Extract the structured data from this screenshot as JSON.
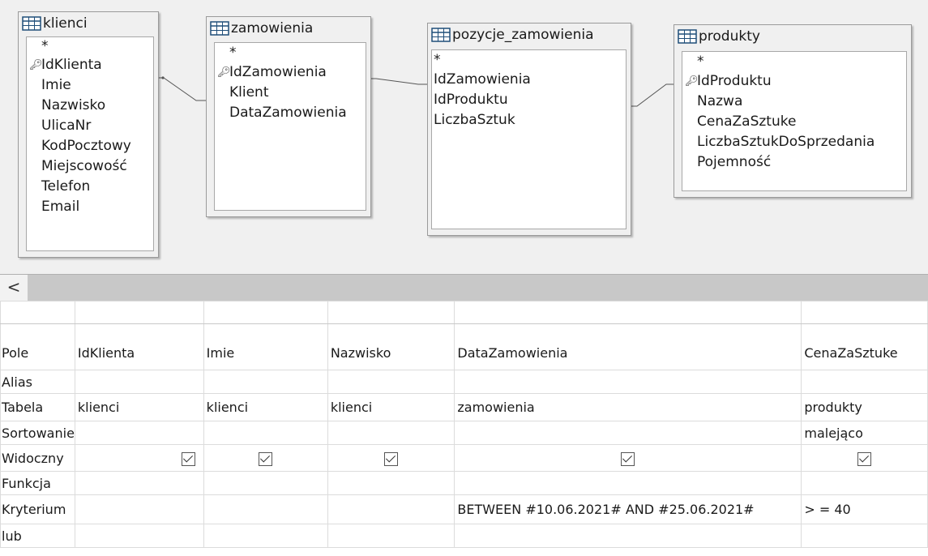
{
  "tables": {
    "klienci": {
      "title": "klienci",
      "fields": [
        "*",
        "IdKlienta",
        "Imie",
        "Nazwisko",
        "UlicaNr",
        "KodPocztowy",
        "Miejscowość",
        "Telefon",
        "Email"
      ],
      "primary_key": "IdKlienta"
    },
    "zamowienia": {
      "title": "zamowienia",
      "fields": [
        "*",
        "IdZamowienia",
        "Klient",
        "DataZamowienia"
      ],
      "primary_key": "IdZamowienia"
    },
    "pozycje_zamowienia": {
      "title": "pozycje_zamowienia",
      "fields": [
        "*",
        "IdZamowienia",
        "IdProduktu",
        "LiczbaSztuk"
      ],
      "primary_key": ""
    },
    "produkty": {
      "title": "produkty",
      "fields": [
        "*",
        "IdProduktu",
        "Nazwa",
        "CenaZaSztuke",
        "LiczbaSztukDoSprzedania",
        "Pojemność"
      ],
      "primary_key": "IdProduktu"
    }
  },
  "scroll": {
    "left_arrow": "<"
  },
  "grid": {
    "row_labels": {
      "pole": "Pole",
      "alias": "Alias",
      "tabela": "Tabela",
      "sortowanie": "Sortowanie",
      "widoczny": "Widoczny",
      "funkcja": "Funkcja",
      "kryterium": "Kryterium",
      "lub": "lub"
    },
    "columns": [
      {
        "pole": "IdKlienta",
        "alias": "",
        "tabela": "klienci",
        "sortowanie": "",
        "widoczny": true,
        "funkcja": "",
        "kryterium": "",
        "lub": ""
      },
      {
        "pole": "Imie",
        "alias": "",
        "tabela": "klienci",
        "sortowanie": "",
        "widoczny": true,
        "funkcja": "",
        "kryterium": "",
        "lub": ""
      },
      {
        "pole": "Nazwisko",
        "alias": "",
        "tabela": "klienci",
        "sortowanie": "",
        "widoczny": true,
        "funkcja": "",
        "kryterium": "",
        "lub": ""
      },
      {
        "pole": "DataZamowienia",
        "alias": "",
        "tabela": "zamowienia",
        "sortowanie": "",
        "widoczny": true,
        "funkcja": "",
        "kryterium": "BETWEEN #10.06.2021# AND #25.06.2021#",
        "lub": ""
      },
      {
        "pole": "CenaZaSztuke",
        "alias": "",
        "tabela": "produkty",
        "sortowanie": "malejąco",
        "widoczny": true,
        "funkcja": "",
        "kryterium": "> = 40",
        "lub": ""
      }
    ]
  }
}
